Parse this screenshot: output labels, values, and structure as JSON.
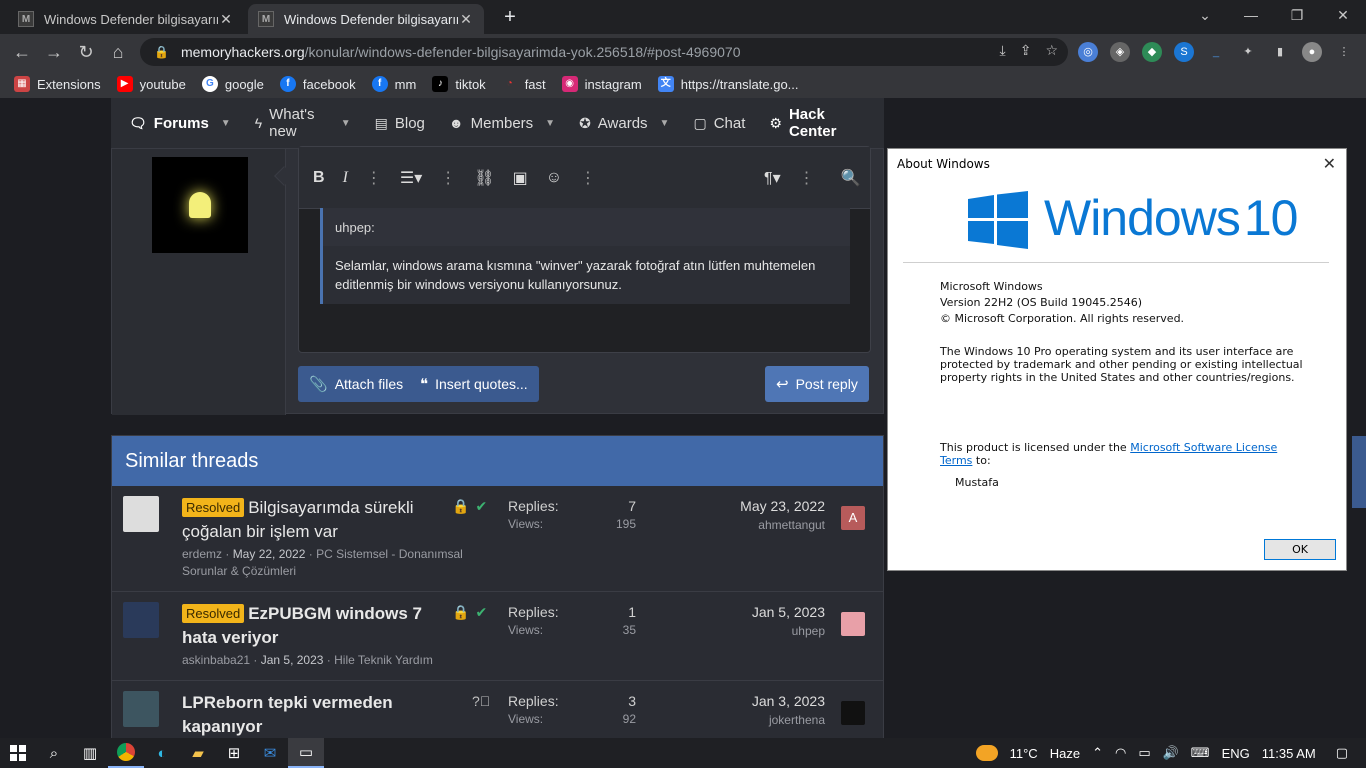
{
  "browser": {
    "tabs": [
      {
        "title": "Windows Defender bilgisayarımda yok | Memory Hackers",
        "active": false
      },
      {
        "title": "Windows Defender bilgisayarımda yok | Memory Hackers",
        "active": true
      }
    ],
    "url_host": "memoryhackers.org",
    "url_path": "/konular/windows-defender-bilgisayarimda-yok.256518/#post-4969070",
    "bookmarks": [
      "Extensions",
      "youtube",
      "google",
      "facebook",
      "mm",
      "tiktok",
      "fast",
      "instagram",
      "https://translate.go..."
    ]
  },
  "forum_nav": [
    {
      "label": "Forums",
      "icon": "comments-icon",
      "caret": true
    },
    {
      "label": "What's new",
      "icon": "bolt-icon",
      "caret": true
    },
    {
      "label": "Blog",
      "icon": "newspaper-icon",
      "caret": false
    },
    {
      "label": "Members",
      "icon": "users-icon",
      "caret": true
    },
    {
      "label": "Awards",
      "icon": "medal-icon",
      "caret": true
    },
    {
      "label": "Chat",
      "icon": "chat-icon",
      "caret": false
    },
    {
      "label": "Hack Center",
      "icon": "robot-icon",
      "caret": false
    }
  ],
  "editor": {
    "quote_author": "uhpep:",
    "quote_text": "Selamlar, windows arama kısmına \"winver\" yazarak fotoğraf atın lütfen muhtemelen editlenmiş bir windows versiyonu kullanıyorsunuz.",
    "attach_label": "Attach files",
    "insert_quotes_label": "Insert quotes...",
    "post_reply_label": "Post reply"
  },
  "similar": {
    "heading": "Similar threads",
    "replies_label": "Replies:",
    "views_label": "Views:",
    "threads": [
      {
        "badge": "Resolved",
        "title": "Bilgisayarımda sürekli çoğalan bir işlem var",
        "bold": false,
        "author": "erdemz",
        "date": "May 22, 2022",
        "forum": "PC Sistemsel - Donanımsal Sorunlar & Çözümleri",
        "replies": "7",
        "views": "195",
        "last_date": "May 23, 2022",
        "last_user": "ahmettangut",
        "last_avatar": "A"
      },
      {
        "badge": "Resolved",
        "title": "EzPUBGM windows 7 hata veriyor",
        "bold": true,
        "author": "askinbaba21",
        "date": "Jan 5, 2023",
        "forum": "Hile Teknik Yardım",
        "replies": "1",
        "views": "35",
        "last_date": "Jan 5, 2023",
        "last_user": "uhpep",
        "last_avatar": ""
      },
      {
        "badge": "",
        "title": "LPReborn tepki vermeden kapanıyor",
        "bold": true,
        "author": "",
        "date": "",
        "forum": "",
        "replies": "3",
        "views": "92",
        "last_date": "Jan 3, 2023",
        "last_user": "jokerthena",
        "last_avatar": ""
      }
    ]
  },
  "about": {
    "title": "About Windows",
    "brand": "Windows",
    "brand_version": "10",
    "product": "Microsoft Windows",
    "version": "Version 22H2 (OS Build 19045.2546)",
    "copyright": "© Microsoft Corporation. All rights reserved.",
    "legal": "The Windows 10 Pro operating system and its user interface are protected by trademark and other pending or existing intellectual property rights in the United States and other countries/regions.",
    "license_prefix": "This product is licensed under the",
    "license_link_1": "Microsoft Software License",
    "license_link_2": "Terms",
    "license_suffix": "to:",
    "licensee": "Mustafa",
    "ok_label": "OK"
  },
  "taskbar": {
    "temperature": "11°C",
    "weather": "Haze",
    "language": "ENG",
    "time": "11:35 AM"
  },
  "colors": {
    "accent": "#4169a8",
    "resolved": "#f2b41a",
    "windows_blue": "#0a78d4"
  }
}
